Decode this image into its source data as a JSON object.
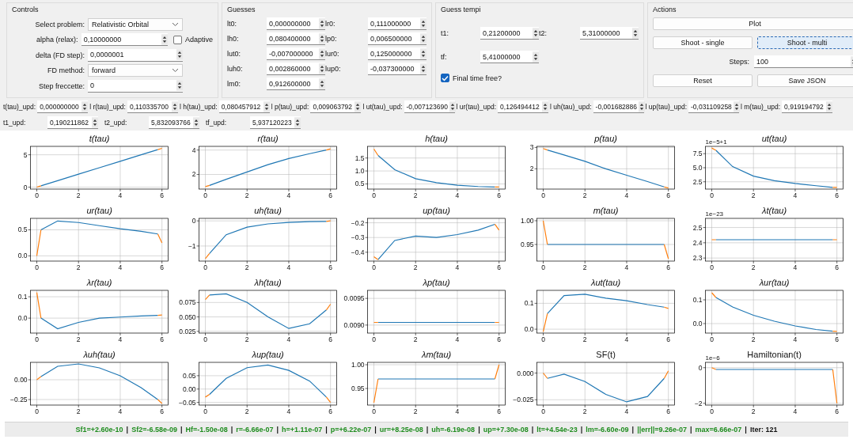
{
  "controls": {
    "title": "Controls",
    "rows": [
      {
        "kind": "combo",
        "label": "Select problem:",
        "value": "Relativistic Orbital"
      },
      {
        "kind": "spin",
        "label": "alpha (relax):",
        "value": "0,10000000",
        "checkbox": {
          "label": "Adaptive",
          "checked": false
        }
      },
      {
        "kind": "spin",
        "label": "delta (FD step):",
        "value": "0,0000001"
      },
      {
        "kind": "combo",
        "label": "FD method:",
        "value": "forward"
      },
      {
        "kind": "spin",
        "label": "Step freccette:",
        "value": "0"
      }
    ]
  },
  "guesses": {
    "title": "Guesses",
    "fields": [
      {
        "label": "lt0:",
        "value": "0,000000000"
      },
      {
        "label": "lr0:",
        "value": "0,111000000"
      },
      {
        "label": "lh0:",
        "value": "0,080400000"
      },
      {
        "label": "lp0:",
        "value": "0,006500000"
      },
      {
        "label": "lut0:",
        "value": "-0,007000000"
      },
      {
        "label": "lur0:",
        "value": "0,125000000"
      },
      {
        "label": "luh0:",
        "value": "0,002860000"
      },
      {
        "label": "lup0:",
        "value": "-0,037300000"
      },
      {
        "label": "lm0:",
        "value": "0,912600000"
      }
    ]
  },
  "guess_tempi": {
    "title": "Guess tempi",
    "fields": [
      {
        "label": "t1:",
        "value": "0,21200000"
      },
      {
        "label": "t2:",
        "value": "5,31000000"
      },
      {
        "label": "tf:",
        "value": "5,41000000"
      }
    ],
    "checkbox": {
      "label": "Final time free?",
      "checked": true
    }
  },
  "actions": {
    "title": "Actions",
    "rows": [
      [
        {
          "kind": "button",
          "label": "Plot",
          "focused": false
        }
      ],
      [
        {
          "kind": "button",
          "label": "Shoot - single",
          "focused": false
        },
        {
          "kind": "button",
          "label": "Shoot - multi",
          "focused": true
        }
      ],
      [
        {
          "kind": "spin",
          "label": "Steps:",
          "value": "100"
        }
      ],
      [
        {
          "kind": "button",
          "label": "Reset",
          "focused": false
        },
        {
          "kind": "button",
          "label": "Save JSON",
          "focused": false
        }
      ]
    ]
  },
  "updates": [
    [
      {
        "label": "t(tau)_upd:",
        "value": "0,000000000"
      },
      {
        "label": "l r(tau)_upd:",
        "value": "0,110335700"
      },
      {
        "label": "l h(tau)_upd:",
        "value": "0,080457912"
      },
      {
        "label": "l p(tau)_upd:",
        "value": "0,009063792"
      },
      {
        "label": "l ut(tau)_upd:",
        "value": "-0,007123690"
      },
      {
        "label": "l ur(tau)_upd:",
        "value": "0,126494412"
      },
      {
        "label": "l uh(tau)_upd:",
        "value": "-0,001682886"
      },
      {
        "label": "l up(tau)_upd:",
        "value": "-0,031109258"
      },
      {
        "label": "l m(tau)_upd:",
        "value": "0,919194792"
      }
    ],
    [
      {
        "label": "t1_upd:",
        "value": "0,190211862"
      },
      {
        "label": "t2_upd:",
        "value": "5,832093766"
      },
      {
        "label": "tf_upd:",
        "value": "5,937120223"
      }
    ]
  ],
  "plots": [
    {
      "italic": true,
      "chart_data": {
        "type": "line",
        "title": "t(tau)",
        "x": [
          0,
          0.2,
          1,
          2,
          3,
          4,
          5,
          5.8,
          6
        ],
        "series": [
          {
            "color": "#1f77b4",
            "values": [
              null,
              0.2,
              1,
              2,
              3,
              4,
              5,
              5.8,
              null
            ]
          },
          {
            "color": "#ff7f0e",
            "values": [
              0,
              0.2,
              null,
              null,
              null,
              null,
              null,
              5.8,
              6
            ]
          }
        ],
        "grid": true,
        "xlim": [
          -0.3,
          6.3
        ],
        "ylim": [
          -0.3,
          6.3
        ],
        "xticks": [
          0,
          2,
          4,
          6
        ],
        "yticks": [
          {
            "value": 0,
            "label": "0"
          },
          {
            "value": 5,
            "label": "5"
          }
        ]
      }
    },
    {
      "italic": true,
      "chart_data": {
        "type": "line",
        "title": "r(tau)",
        "x": [
          0,
          0.2,
          1,
          2,
          3,
          4,
          5,
          5.8,
          6
        ],
        "series": [
          {
            "color": "#1f77b4",
            "values": [
              null,
              1.1,
              1.6,
              2.2,
              2.8,
              3.3,
              3.7,
              4.0,
              null
            ]
          },
          {
            "color": "#ff7f0e",
            "values": [
              1.0,
              1.1,
              null,
              null,
              null,
              null,
              null,
              4.0,
              4.1
            ]
          }
        ],
        "grid": true,
        "xlim": [
          -0.3,
          6.3
        ],
        "ylim": [
          0.8,
          4.3
        ],
        "xticks": [
          0,
          2,
          4,
          6
        ],
        "yticks": [
          {
            "value": 2,
            "label": "2"
          },
          {
            "value": 4,
            "label": "4"
          }
        ]
      }
    },
    {
      "italic": true,
      "chart_data": {
        "type": "line",
        "title": "h(tau)",
        "x": [
          0,
          0.2,
          1,
          2,
          3,
          4,
          5,
          5.8,
          6
        ],
        "series": [
          {
            "color": "#1f77b4",
            "values": [
              null,
              1.6,
              1.05,
              0.7,
              0.55,
              0.45,
              0.4,
              0.38,
              null
            ]
          },
          {
            "color": "#ff7f0e",
            "values": [
              1.85,
              1.6,
              null,
              null,
              null,
              null,
              null,
              0.38,
              0.38
            ]
          }
        ],
        "grid": true,
        "xlim": [
          -0.3,
          6.3
        ],
        "ylim": [
          0.3,
          1.95
        ],
        "xticks": [
          0,
          2,
          4,
          6
        ],
        "yticks": [
          {
            "value": 0.5,
            "label": "0.5"
          },
          {
            "value": 1,
            "label": "1.0"
          },
          {
            "value": 1.5,
            "label": "1.5"
          }
        ]
      }
    },
    {
      "italic": true,
      "chart_data": {
        "type": "line",
        "title": "p(tau)",
        "x": [
          0,
          0.2,
          1,
          2,
          3,
          4,
          5,
          5.8,
          6
        ],
        "series": [
          {
            "color": "#1f77b4",
            "values": [
              null,
              2.88,
              2.65,
              2.35,
              2.0,
              1.7,
              1.4,
              1.15,
              null
            ]
          },
          {
            "color": "#ff7f0e",
            "values": [
              2.95,
              2.88,
              null,
              null,
              null,
              null,
              null,
              1.15,
              1.1
            ]
          }
        ],
        "grid": true,
        "xlim": [
          -0.3,
          6.3
        ],
        "ylim": [
          1.05,
          3.05
        ],
        "xticks": [
          0,
          2,
          4,
          6
        ],
        "yticks": [
          {
            "value": 2,
            "label": "2"
          },
          {
            "value": 3,
            "label": "3"
          }
        ]
      }
    },
    {
      "italic": true,
      "offset_label": "1e−5+1",
      "chart_data": {
        "type": "line",
        "title": "ut(tau)",
        "x": [
          0,
          0.2,
          1,
          2,
          3,
          4,
          5,
          5.8,
          6
        ],
        "series": [
          {
            "color": "#1f77b4",
            "values": [
              null,
              8.1,
              5.2,
              3.5,
              2.7,
              2.2,
              1.8,
              1.5,
              null
            ]
          },
          {
            "color": "#ff7f0e",
            "values": [
              8.5,
              8.1,
              null,
              null,
              null,
              null,
              null,
              1.5,
              1.5
            ]
          }
        ],
        "grid": true,
        "xlim": [
          -0.3,
          6.3
        ],
        "ylim": [
          1.2,
          8.8
        ],
        "xticks": [
          0,
          2,
          4,
          6
        ],
        "yticks": [
          {
            "value": 2.5,
            "label": "2.5"
          },
          {
            "value": 5,
            "label": "5.0"
          },
          {
            "value": 7.5,
            "label": "7.5"
          }
        ]
      }
    },
    {
      "italic": true,
      "chart_data": {
        "type": "line",
        "title": "ur(tau)",
        "x": [
          0,
          0.2,
          1,
          2,
          3,
          4,
          5,
          5.8,
          6
        ],
        "series": [
          {
            "color": "#1f77b4",
            "values": [
              null,
              0.5,
              0.67,
              0.64,
              0.58,
              0.52,
              0.47,
              0.42,
              null
            ]
          },
          {
            "color": "#ff7f0e",
            "values": [
              0.0,
              0.5,
              null,
              null,
              null,
              null,
              null,
              0.42,
              0.25
            ]
          }
        ],
        "grid": true,
        "xlim": [
          -0.3,
          6.3
        ],
        "ylim": [
          -0.1,
          0.72
        ],
        "xticks": [
          0,
          2,
          4,
          6
        ],
        "yticks": [
          {
            "value": 0,
            "label": "0.0"
          },
          {
            "value": 0.5,
            "label": "0.5"
          }
        ]
      }
    },
    {
      "italic": true,
      "chart_data": {
        "type": "line",
        "title": "uh(tau)",
        "x": [
          0,
          0.2,
          1,
          2,
          3,
          4,
          5,
          5.8,
          6
        ],
        "series": [
          {
            "color": "#1f77b4",
            "values": [
              null,
              -1.3,
              -0.55,
              -0.25,
              -0.12,
              -0.06,
              -0.03,
              -0.02,
              null
            ]
          },
          {
            "color": "#ff7f0e",
            "values": [
              -1.5,
              -1.3,
              null,
              null,
              null,
              null,
              null,
              -0.02,
              0.0
            ]
          }
        ],
        "grid": true,
        "xlim": [
          -0.3,
          6.3
        ],
        "ylim": [
          -1.6,
          0.1
        ],
        "xticks": [
          0,
          2,
          4,
          6
        ],
        "yticks": [
          {
            "value": -1,
            "label": "−1"
          },
          {
            "value": 0,
            "label": "0"
          }
        ]
      }
    },
    {
      "italic": true,
      "chart_data": {
        "type": "line",
        "title": "up(tau)",
        "x": [
          0,
          0.2,
          1,
          2,
          3,
          4,
          5,
          5.8,
          6
        ],
        "series": [
          {
            "color": "#1f77b4",
            "values": [
              null,
              -0.45,
              -0.32,
              -0.29,
              -0.3,
              -0.28,
              -0.25,
              -0.21,
              null
            ]
          },
          {
            "color": "#ff7f0e",
            "values": [
              -0.43,
              -0.45,
              null,
              null,
              null,
              null,
              null,
              -0.21,
              -0.25
            ]
          }
        ],
        "grid": true,
        "xlim": [
          -0.3,
          6.3
        ],
        "ylim": [
          -0.46,
          -0.17
        ],
        "xticks": [
          0,
          2,
          4,
          6
        ],
        "yticks": [
          {
            "value": -0.4,
            "label": "−0.4"
          },
          {
            "value": -0.3,
            "label": "−0.3"
          },
          {
            "value": -0.2,
            "label": "−0.2"
          }
        ]
      }
    },
    {
      "italic": true,
      "chart_data": {
        "type": "line",
        "title": "m(tau)",
        "x": [
          0,
          0.2,
          1,
          2,
          3,
          4,
          5,
          5.8,
          6
        ],
        "series": [
          {
            "color": "#1f77b4",
            "values": [
              null,
              0.95,
              0.95,
              0.95,
              0.95,
              0.95,
              0.95,
              0.95,
              null
            ]
          },
          {
            "color": "#ff7f0e",
            "values": [
              1.0,
              0.95,
              null,
              null,
              null,
              null,
              null,
              0.95,
              0.92
            ]
          }
        ],
        "grid": true,
        "xlim": [
          -0.3,
          6.3
        ],
        "ylim": [
          0.915,
          1.005
        ],
        "xticks": [
          0,
          2,
          4,
          6
        ],
        "yticks": [
          {
            "value": 0.95,
            "label": "0.95"
          },
          {
            "value": 1,
            "label": "1.00"
          }
        ]
      }
    },
    {
      "italic": true,
      "offset_label": "1e−23",
      "chart_data": {
        "type": "line",
        "title": "λt(tau)",
        "x": [
          0,
          0.2,
          1,
          2,
          3,
          4,
          5,
          5.8,
          6
        ],
        "series": [
          {
            "color": "#1f77b4",
            "values": [
              null,
              2.42,
              2.42,
              2.42,
              2.42,
              2.42,
              2.42,
              2.42,
              null
            ]
          },
          {
            "color": "#ff7f0e",
            "values": [
              2.42,
              2.42,
              null,
              null,
              null,
              null,
              null,
              2.42,
              2.42
            ]
          }
        ],
        "grid": true,
        "xlim": [
          -0.3,
          6.3
        ],
        "ylim": [
          2.28,
          2.56
        ],
        "xticks": [
          0,
          2,
          4,
          6
        ],
        "yticks": [
          {
            "value": 2.3,
            "label": "2.3"
          },
          {
            "value": 2.4,
            "label": "2.4"
          },
          {
            "value": 2.5,
            "label": "2.5"
          }
        ]
      }
    },
    {
      "italic": true,
      "chart_data": {
        "type": "line",
        "title": "λr(tau)",
        "x": [
          0,
          0.2,
          1,
          2,
          3,
          4,
          5,
          5.8,
          6
        ],
        "series": [
          {
            "color": "#1f77b4",
            "values": [
              null,
              0.0,
              -0.05,
              -0.02,
              0.0,
              0.005,
              0.01,
              0.013,
              null
            ]
          },
          {
            "color": "#ff7f0e",
            "values": [
              0.12,
              0.0,
              null,
              null,
              null,
              null,
              null,
              0.013,
              0.015
            ]
          }
        ],
        "grid": true,
        "xlim": [
          -0.3,
          6.3
        ],
        "ylim": [
          -0.07,
          0.13
        ],
        "xticks": [
          0,
          2,
          4,
          6
        ],
        "yticks": [
          {
            "value": 0,
            "label": "0.0"
          },
          {
            "value": 0.1,
            "label": "0.1"
          }
        ]
      }
    },
    {
      "italic": true,
      "chart_data": {
        "type": "line",
        "title": "λh(tau)",
        "x": [
          0,
          0.2,
          1,
          2,
          3,
          4,
          5,
          5.8,
          6
        ],
        "series": [
          {
            "color": "#1f77b4",
            "values": [
              null,
              0.088,
              0.09,
              0.075,
              0.05,
              0.03,
              0.038,
              0.062,
              null
            ]
          },
          {
            "color": "#ff7f0e",
            "values": [
              0.08,
              0.088,
              null,
              null,
              null,
              null,
              null,
              0.062,
              0.072
            ]
          }
        ],
        "grid": true,
        "xlim": [
          -0.3,
          6.3
        ],
        "ylim": [
          0.022,
          0.096
        ],
        "xticks": [
          0,
          2,
          4,
          6
        ],
        "yticks": [
          {
            "value": 0.025,
            "label": "0.025"
          },
          {
            "value": 0.05,
            "label": "0.050"
          },
          {
            "value": 0.075,
            "label": "0.075"
          }
        ]
      }
    },
    {
      "italic": true,
      "chart_data": {
        "type": "line",
        "title": "λp(tau)",
        "x": [
          0,
          0.2,
          1,
          2,
          3,
          4,
          5,
          5.8,
          6
        ],
        "series": [
          {
            "color": "#1f77b4",
            "values": [
              null,
              0.00905,
              0.00905,
              0.00905,
              0.00905,
              0.00905,
              0.00905,
              0.00905,
              null
            ]
          },
          {
            "color": "#ff7f0e",
            "values": [
              0.00905,
              0.00905,
              null,
              null,
              null,
              null,
              null,
              0.00905,
              0.00905
            ]
          }
        ],
        "grid": true,
        "xlim": [
          -0.3,
          6.3
        ],
        "ylim": [
          0.00885,
          0.00965
        ],
        "xticks": [
          0,
          2,
          4,
          6
        ],
        "yticks": [
          {
            "value": 0.009,
            "label": "0.0090"
          },
          {
            "value": 0.0095,
            "label": "0.0095"
          }
        ]
      }
    },
    {
      "italic": true,
      "chart_data": {
        "type": "line",
        "title": "λut(tau)",
        "x": [
          0,
          0.2,
          1,
          2,
          3,
          4,
          5,
          5.8,
          6
        ],
        "series": [
          {
            "color": "#1f77b4",
            "values": [
              null,
              0.06,
              0.13,
              0.135,
              0.12,
              0.11,
              0.095,
              0.085,
              null
            ]
          },
          {
            "color": "#ff7f0e",
            "values": [
              -0.01,
              0.06,
              null,
              null,
              null,
              null,
              null,
              0.085,
              0.08
            ]
          }
        ],
        "grid": true,
        "xlim": [
          -0.3,
          6.3
        ],
        "ylim": [
          -0.015,
          0.15
        ],
        "xticks": [
          0,
          2,
          4,
          6
        ],
        "yticks": [
          {
            "value": 0,
            "label": "0.0"
          },
          {
            "value": 0.1,
            "label": "0.1"
          }
        ]
      }
    },
    {
      "italic": true,
      "chart_data": {
        "type": "line",
        "title": "λur(tau)",
        "x": [
          0,
          0.2,
          1,
          2,
          3,
          4,
          5,
          5.8,
          6
        ],
        "series": [
          {
            "color": "#1f77b4",
            "values": [
              null,
              0.11,
              0.07,
              0.035,
              0.01,
              -0.01,
              -0.025,
              -0.032,
              null
            ]
          },
          {
            "color": "#ff7f0e",
            "values": [
              0.13,
              0.11,
              null,
              null,
              null,
              null,
              null,
              -0.032,
              -0.033
            ]
          }
        ],
        "grid": true,
        "xlim": [
          -0.3,
          6.3
        ],
        "ylim": [
          -0.04,
          0.14
        ],
        "xticks": [
          0,
          2,
          4,
          6
        ],
        "yticks": [
          {
            "value": 0,
            "label": "0.0"
          },
          {
            "value": 0.1,
            "label": "0.1"
          }
        ]
      }
    },
    {
      "italic": true,
      "chart_data": {
        "type": "line",
        "title": "λuh(tau)",
        "x": [
          0,
          0.2,
          1,
          2,
          3,
          4,
          5,
          5.8,
          6
        ],
        "series": [
          {
            "color": "#1f77b4",
            "values": [
              null,
              0.04,
              0.17,
              0.2,
              0.15,
              0.05,
              -0.1,
              -0.25,
              null
            ]
          },
          {
            "color": "#ff7f0e",
            "values": [
              0.0,
              0.04,
              null,
              null,
              null,
              null,
              null,
              -0.25,
              -0.3
            ]
          }
        ],
        "grid": true,
        "xlim": [
          -0.3,
          6.3
        ],
        "ylim": [
          -0.32,
          0.22
        ],
        "xticks": [
          0,
          2,
          4,
          6
        ],
        "yticks": [
          {
            "value": -0.25,
            "label": "−0.25"
          },
          {
            "value": 0,
            "label": "0.00"
          }
        ]
      }
    },
    {
      "italic": true,
      "chart_data": {
        "type": "line",
        "title": "λup(tau)",
        "x": [
          0,
          0.2,
          1,
          2,
          3,
          4,
          5,
          5.8,
          6
        ],
        "series": [
          {
            "color": "#1f77b4",
            "values": [
              null,
              -0.02,
              0.04,
              0.08,
              0.09,
              0.07,
              0.03,
              -0.03,
              null
            ]
          },
          {
            "color": "#ff7f0e",
            "values": [
              -0.03,
              -0.02,
              null,
              null,
              null,
              null,
              null,
              -0.03,
              -0.05
            ]
          }
        ],
        "grid": true,
        "xlim": [
          -0.3,
          6.3
        ],
        "ylim": [
          -0.06,
          0.1
        ],
        "xticks": [
          0,
          2,
          4,
          6
        ],
        "yticks": [
          {
            "value": -0.05,
            "label": "−0.05"
          },
          {
            "value": 0,
            "label": "0.00"
          },
          {
            "value": 0.05,
            "label": "0.05"
          }
        ]
      }
    },
    {
      "italic": true,
      "chart_data": {
        "type": "line",
        "title": "λm(tau)",
        "x": [
          0,
          0.2,
          1,
          2,
          3,
          4,
          5,
          5.8,
          6
        ],
        "series": [
          {
            "color": "#1f77b4",
            "values": [
              null,
              0.97,
              0.97,
              0.97,
              0.97,
              0.97,
              0.97,
              0.97,
              null
            ]
          },
          {
            "color": "#ff7f0e",
            "values": [
              0.92,
              0.97,
              null,
              null,
              null,
              null,
              null,
              0.97,
              1.0
            ]
          }
        ],
        "grid": true,
        "xlim": [
          -0.3,
          6.3
        ],
        "ylim": [
          0.915,
          1.005
        ],
        "xticks": [
          0,
          2,
          4,
          6
        ],
        "yticks": [
          {
            "value": 0.95,
            "label": "0.95"
          },
          {
            "value": 1,
            "label": "1.00"
          }
        ]
      }
    },
    {
      "italic": false,
      "chart_data": {
        "type": "line",
        "title": "SF(t)",
        "x": [
          0,
          0.2,
          1,
          2,
          3,
          4,
          5,
          5.8,
          6
        ],
        "series": [
          {
            "color": "#1f77b4",
            "values": [
              null,
              -0.005,
              -0.001,
              -0.008,
              -0.02,
              -0.027,
              -0.022,
              -0.005,
              null
            ]
          },
          {
            "color": "#ff7f0e",
            "values": [
              0.0,
              -0.005,
              null,
              null,
              null,
              null,
              null,
              -0.005,
              0.002
            ]
          }
        ],
        "grid": true,
        "xlim": [
          -0.3,
          6.3
        ],
        "ylim": [
          -0.03,
          0.01
        ],
        "xticks": [
          0,
          2,
          4,
          6
        ],
        "yticks": [
          {
            "value": -0.025,
            "label": "−0.025"
          },
          {
            "value": 0,
            "label": "0.000"
          }
        ]
      }
    },
    {
      "italic": false,
      "offset_label": "1e−6",
      "chart_data": {
        "type": "line",
        "title": "Hamiltonian(t)",
        "x": [
          0,
          0.2,
          1,
          2,
          3,
          4,
          5,
          5.8,
          6
        ],
        "series": [
          {
            "color": "#1f77b4",
            "values": [
              null,
              -0.1,
              -0.1,
              -0.1,
              -0.1,
              -0.1,
              -0.1,
              -0.1,
              null
            ]
          },
          {
            "color": "#ff7f0e",
            "values": [
              0.0,
              -0.1,
              null,
              null,
              null,
              null,
              null,
              -0.1,
              -2.0
            ]
          }
        ],
        "grid": true,
        "xlim": [
          -0.3,
          6.3
        ],
        "ylim": [
          -2.1,
          0.3
        ],
        "xticks": [
          0,
          2,
          4,
          6
        ],
        "yticks": [
          {
            "value": -2,
            "label": "−2"
          },
          {
            "value": 0,
            "label": "0"
          }
        ]
      }
    }
  ],
  "status_bar": [
    {
      "text": "Sf1=+2.60e-10",
      "color": "#1e8c1e",
      "separator": "|"
    },
    {
      "text": "Sf2=-6.58e-09",
      "color": "#1e8c1e",
      "separator": "|"
    },
    {
      "text": "Hf=-1.50e-08",
      "color": "#1e8c1e",
      "separator": "|"
    },
    {
      "text": "r=-6.66e-07",
      "color": "#1e8c1e",
      "separator": "|"
    },
    {
      "text": "h=+1.11e-07",
      "color": "#1e8c1e",
      "separator": "|"
    },
    {
      "text": "p=+6.22e-07",
      "color": "#1e8c1e",
      "separator": "|"
    },
    {
      "text": "ur=+8.25e-08",
      "color": "#1e8c1e",
      "separator": "|"
    },
    {
      "text": "uh=-6.19e-08",
      "color": "#1e8c1e",
      "separator": "|"
    },
    {
      "text": "up=+7.30e-08",
      "color": "#1e8c1e",
      "separator": "|"
    },
    {
      "text": "lt=+4.54e-23",
      "color": "#1e8c1e",
      "separator": "|"
    },
    {
      "text": "lm=-6.60e-09",
      "color": "#1e8c1e",
      "separator": "|"
    },
    {
      "text": "||err||=9.26e-07",
      "color": "#1e8c1e",
      "separator": "|"
    },
    {
      "text": "max=6.66e-07",
      "color": "#1e8c1e",
      "separator": "|"
    },
    {
      "text": "Iter: 121",
      "color": "#111111"
    }
  ]
}
